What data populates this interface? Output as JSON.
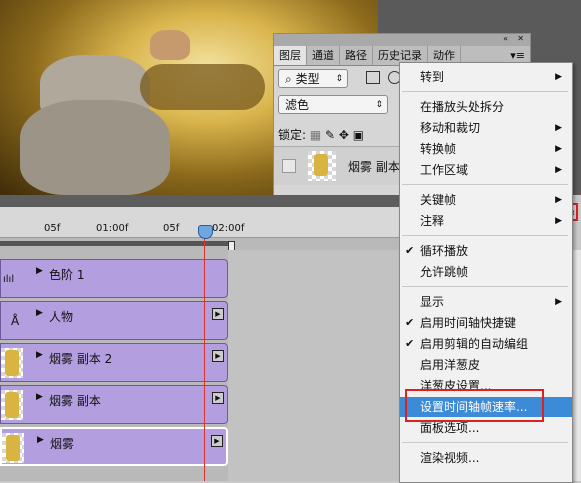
{
  "layers_panel": {
    "tabs": [
      "图层",
      "通道",
      "路径",
      "历史记录",
      "动作"
    ],
    "kind_filter": "类型",
    "blend_mode": "滤色",
    "lock_label": "锁定:",
    "layer_name": "烟雾 副本"
  },
  "timeline": {
    "time_marks": [
      "05f",
      "01:00f",
      "05f",
      "02:00f"
    ],
    "tracks": [
      {
        "name": "色阶 1"
      },
      {
        "name": "人物"
      },
      {
        "name": "烟雾 副本 2"
      },
      {
        "name": "烟雾 副本"
      },
      {
        "name": "烟雾"
      }
    ]
  },
  "context_menu": {
    "items": [
      {
        "label": "转到",
        "submenu": true
      },
      {
        "label": "在播放头处拆分"
      },
      {
        "label": "移动和裁切",
        "submenu": true
      },
      {
        "label": "转换帧",
        "submenu": true
      },
      {
        "label": "工作区域",
        "submenu": true
      },
      {
        "label": "关键帧",
        "submenu": true
      },
      {
        "label": "注释",
        "submenu": true
      },
      {
        "label": "循环播放",
        "checked": true
      },
      {
        "label": "允许跳帧"
      },
      {
        "label": "显示",
        "submenu": true
      },
      {
        "label": "启用时间轴快捷键",
        "checked": true
      },
      {
        "label": "启用剪辑的自动编组",
        "checked": true
      },
      {
        "label": "启用洋葱皮"
      },
      {
        "label": "洋葱皮设置..."
      },
      {
        "label": "设置时间轴帧速率...",
        "highlighted": true
      },
      {
        "label": "面板选项..."
      },
      {
        "label": "渲染视频..."
      }
    ]
  },
  "colors": {
    "highlight": "#3b8bd6",
    "annotation_red": "#e02020",
    "track_purple": "#b39ee0",
    "playhead": "#e03030"
  }
}
